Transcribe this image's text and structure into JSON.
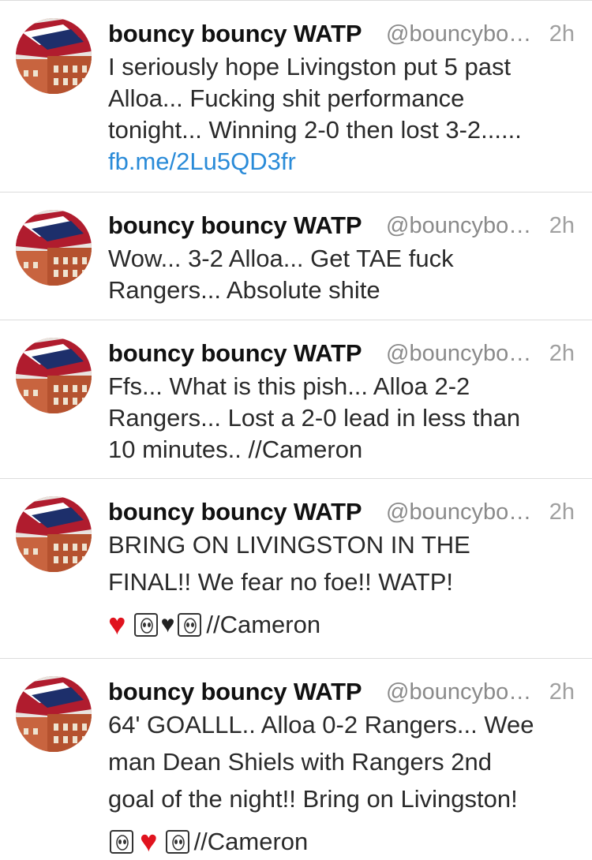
{
  "tweets": [
    {
      "name": "bouncy bouncy WATP",
      "handle": "@bouncybo…",
      "time": "2h",
      "lines": [
        "I seriously hope Livingston put 5 past",
        "Alloa... Fucking shit performance",
        "tonight... Winning 2-0 then lost 3-2......"
      ],
      "link": "fb.me/2Lu5QD3fr"
    },
    {
      "name": "bouncy bouncy WATP",
      "handle": "@bouncybo…",
      "time": "2h",
      "lines": [
        "Wow... 3-2 Alloa... Get TAE fuck",
        "Rangers... Absolute shite"
      ]
    },
    {
      "name": "bouncy bouncy WATP",
      "handle": "@bouncybo…",
      "time": "2h",
      "lines": [
        "Ffs... What is this pish... Alloa 2-2",
        "Rangers... Lost a 2-0 lead in less than",
        "10 minutes.. //Cameron"
      ]
    },
    {
      "name": "bouncy bouncy WATP",
      "handle": "@bouncybo…",
      "time": "2h",
      "lines": [
        "BRING ON LIVINGSTON IN THE",
        "FINAL!! We fear no foe!! WATP!"
      ],
      "emoji_text": "//Cameron"
    },
    {
      "name": "bouncy bouncy WATP",
      "handle": "@bouncybo…",
      "time": "2h",
      "lines": [
        "64' GOALLL.. Alloa 0-2 Rangers... Wee",
        "man Dean Shiels with Rangers 2nd",
        "goal of the night!! Bring on Livingston!"
      ],
      "emoji_text": "//Cameron"
    }
  ],
  "colors": {
    "link": "#2a8bd8",
    "heart": "#e0131e",
    "divider": "#dcdcdc"
  },
  "icons": [
    "avatar-image",
    "red-heart-emoji",
    "alien-emoji",
    "black-heart-emoji"
  ]
}
